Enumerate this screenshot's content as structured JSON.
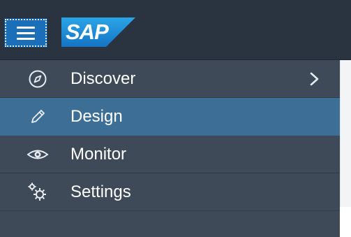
{
  "header": {
    "menu_button_icon": "hamburger-icon",
    "logo_text": "SAP",
    "colors": {
      "header_bg": "#2a3440",
      "logo_blue": "#1d8fd6",
      "button_blue": "#1b6fb8"
    }
  },
  "nav": {
    "colors": {
      "nav_bg": "#3e4a58",
      "selected_bg": "#3d6f96"
    },
    "items": [
      {
        "label": "Discover",
        "icon": "compass-icon",
        "has_submenu": true,
        "selected": false
      },
      {
        "label": "Design",
        "icon": "pencil-icon",
        "has_submenu": false,
        "selected": true
      },
      {
        "label": "Monitor",
        "icon": "eye-icon",
        "has_submenu": false,
        "selected": false
      },
      {
        "label": "Settings",
        "icon": "gears-icon",
        "has_submenu": false,
        "selected": false
      }
    ]
  }
}
